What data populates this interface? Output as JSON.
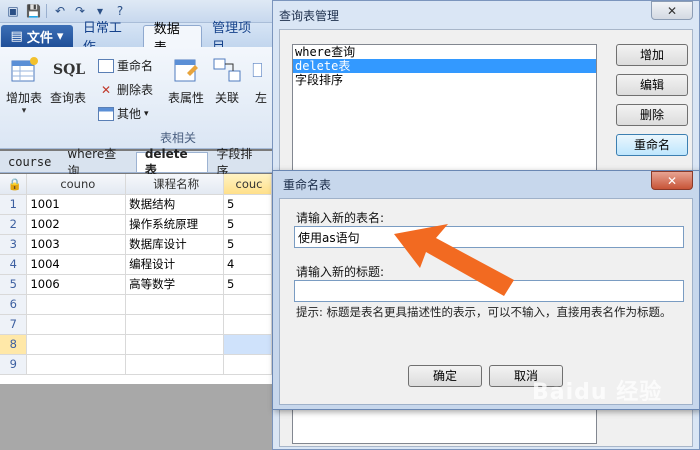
{
  "ribbon": {
    "file_tab": "文件",
    "tabs": [
      "日常工作",
      "数据表",
      "管理项目"
    ],
    "active_tab_index": 1,
    "buttons": {
      "add_table": "增加表",
      "sql": "SQL",
      "query_table": "查询表",
      "rename": "重命名",
      "delete_table": "删除表",
      "other": "其他",
      "table_props": "表属性",
      "relation": "关联",
      "left": "左"
    },
    "group_label": "表相关"
  },
  "doc_tabs": [
    "course",
    "where查询",
    "delete表",
    "字段排序"
  ],
  "active_doc_tab_index": 2,
  "grid": {
    "headers": [
      "couno",
      "课程名称",
      "couc"
    ],
    "rows": [
      {
        "n": "1",
        "couno": "1001",
        "name": "数据结构",
        "c": "5"
      },
      {
        "n": "2",
        "couno": "1002",
        "name": "操作系统原理",
        "c": "5"
      },
      {
        "n": "3",
        "couno": "1003",
        "name": "数据库设计",
        "c": "5"
      },
      {
        "n": "4",
        "couno": "1004",
        "name": "编程设计",
        "c": "4"
      },
      {
        "n": "5",
        "couno": "1006",
        "name": "高等数学",
        "c": "5"
      },
      {
        "n": "6",
        "couno": "",
        "name": "",
        "c": ""
      },
      {
        "n": "7",
        "couno": "",
        "name": "",
        "c": ""
      },
      {
        "n": "8",
        "couno": "",
        "name": "",
        "c": ""
      },
      {
        "n": "9",
        "couno": "",
        "name": "",
        "c": ""
      }
    ],
    "selected_row": "8"
  },
  "query_manager": {
    "title": "查询表管理",
    "items": [
      "where查询",
      "delete表",
      "字段排序"
    ],
    "selected_index": 1,
    "buttons": {
      "add": "增加",
      "edit": "编辑",
      "delete": "删除",
      "rename": "重命名"
    }
  },
  "rename_dialog": {
    "title": "重命名表",
    "name_label": "请输入新的表名:",
    "name_value": "使用as语句",
    "title_label": "请输入新的标题:",
    "title_value": "",
    "hint": "提示: 标题是表名更具描述性的表示，可以不输入，直接用表名作为标题。",
    "ok": "确定",
    "cancel": "取消"
  },
  "watermark": "Baidu 经验",
  "colors": {
    "arrow": "#f26a21",
    "selection": "#3399ff"
  }
}
